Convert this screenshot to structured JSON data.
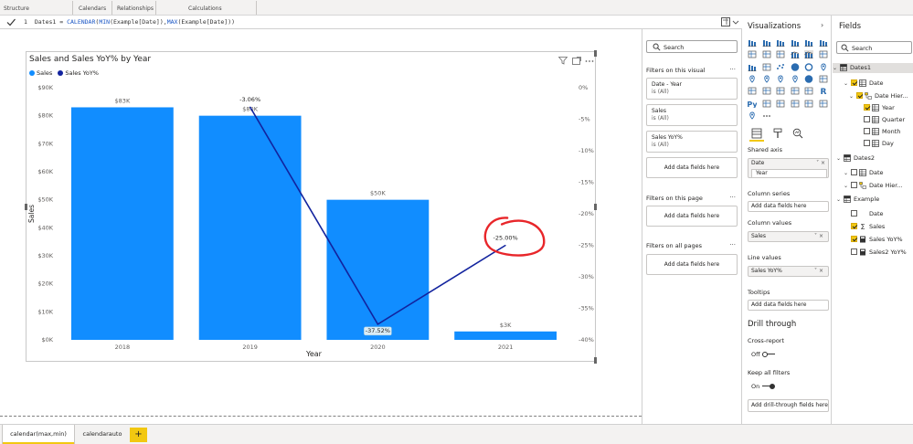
{
  "ribbon": {
    "groups": [
      {
        "label": "Structure"
      },
      {
        "label": "Calendars"
      },
      {
        "label": "Relationships"
      },
      {
        "label": "Calculations"
      }
    ]
  },
  "formula": {
    "line_number": "1",
    "name": "Dates1",
    "op": " = ",
    "func1": "CALENDAR",
    "mid1": "(",
    "func2": "MIN",
    "mid2": "(Example[Date]),",
    "func3": "MAX",
    "mid3": "(Example[Date]))"
  },
  "visual": {
    "title": "Sales and Sales YoY% by Year",
    "legend": [
      {
        "name": "Sales",
        "color": "#118dff"
      },
      {
        "name": "Sales YoY%",
        "color": "#12239e"
      }
    ]
  },
  "chart_data": {
    "type": "bar",
    "title": "Sales and Sales YoY% by Year",
    "categories": [
      "2018",
      "2019",
      "2020",
      "2021"
    ],
    "xlabel": "Year",
    "ylabel": "Sales",
    "y_ticks": [
      "$0K",
      "$10K",
      "$20K",
      "$30K",
      "$40K",
      "$50K",
      "$60K",
      "$70K",
      "$80K",
      "$90K"
    ],
    "y2_ticks": [
      "-40%",
      "-35%",
      "-30%",
      "-25%",
      "-20%",
      "-15%",
      "-10%",
      "-5%",
      "0%"
    ],
    "ylim": [
      0,
      90000
    ],
    "y2lim": [
      -40,
      0
    ],
    "series": [
      {
        "name": "Sales",
        "kind": "bar",
        "color": "#118dff",
        "values": [
          83000,
          80000,
          50000,
          3000
        ],
        "labels": [
          "$83K",
          "$80K",
          "$50K",
          "$3K"
        ]
      },
      {
        "name": "Sales YoY%",
        "kind": "line",
        "color": "#12239e",
        "values": [
          null,
          -3.06,
          -37.52,
          -25.0
        ],
        "labels": [
          "",
          "-3.06%",
          "-37.52%",
          "-25.00%"
        ]
      }
    ],
    "annotation": {
      "type": "hand-drawn circle",
      "color": "#e8262a",
      "target": "2021 Sales YoY%"
    },
    "legend": "top-left",
    "grid": false
  },
  "filters": {
    "search_placeholder": "Search",
    "on_visual": "Filters on this visual",
    "cards": [
      {
        "title": "Date - Year",
        "sub": "is (All)"
      },
      {
        "title": "Sales",
        "sub": "is (All)"
      },
      {
        "title": "Sales YoY%",
        "sub": "is (All)"
      }
    ],
    "add_label": "Add data fields here",
    "on_page": "Filters on this page",
    "on_all": "Filters on all pages"
  },
  "viz": {
    "title": "Visualizations",
    "shared_axis": "Shared axis",
    "shared_axis_items": [
      "Date",
      "Year"
    ],
    "column_series": "Column series",
    "column_values": "Column values",
    "column_values_item": "Sales",
    "line_values": "Line values",
    "line_values_item": "Sales YoY%",
    "tooltips": "Tooltips",
    "add_label": "Add data fields here",
    "drill_through": "Drill through",
    "cross_report": "Cross-report",
    "off": "Off",
    "keep_all_filters": "Keep all filters",
    "on": "On",
    "add_drill": "Add drill-through fields here"
  },
  "fields": {
    "title": "Fields",
    "search_placeholder": "Search",
    "items": [
      {
        "label": "Dates1"
      },
      {
        "label": "Date"
      },
      {
        "label": "Date Hier..."
      },
      {
        "label": "Year"
      },
      {
        "label": "Quarter"
      },
      {
        "label": "Month"
      },
      {
        "label": "Day"
      },
      {
        "label": "Dates2"
      },
      {
        "label": "Date"
      },
      {
        "label": "Date Hier..."
      },
      {
        "label": "Example"
      },
      {
        "label": "Date"
      },
      {
        "label": "Sales"
      },
      {
        "label": "Sales YoY%"
      },
      {
        "label": "Sales2 YoY%"
      }
    ]
  },
  "tabs": {
    "items": [
      "calendar(max,min)",
      "calendarauto"
    ],
    "add": "+"
  }
}
